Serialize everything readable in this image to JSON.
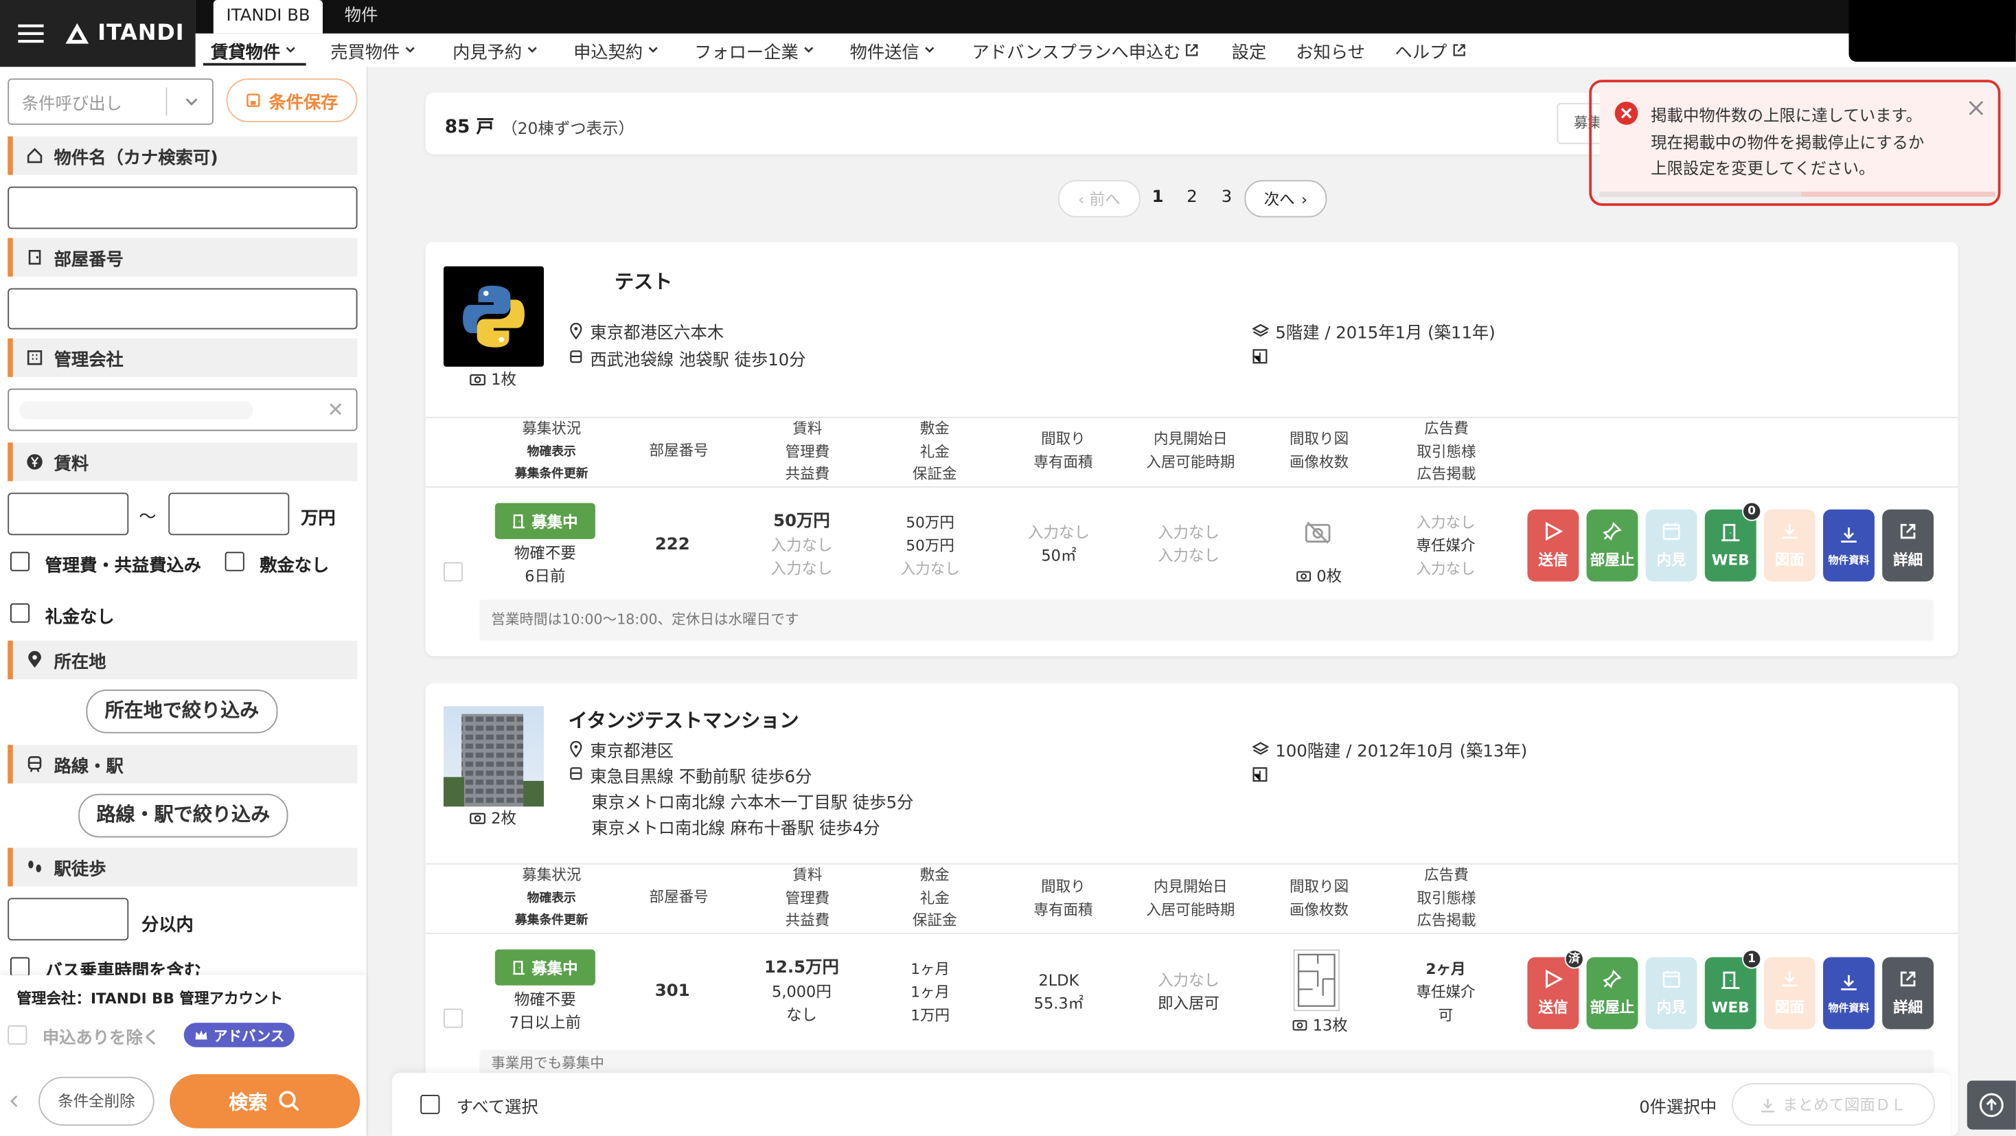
{
  "brand": {
    "name": "ITANDI"
  },
  "top_tabs": [
    "ITANDI BB",
    "物件"
  ],
  "nav": [
    "賃貸物件",
    "売買物件",
    "内見予約",
    "申込契約",
    "フォロー企業",
    "物件送信",
    "アドバンスプランへ申込む",
    "設定",
    "お知らせ",
    "ヘルプ"
  ],
  "sidebar": {
    "saved_select_placeholder": "条件呼び出し",
    "save_button": "条件保存",
    "sections": {
      "name": "物件名（カナ検索可)",
      "room": "部屋番号",
      "company": "管理会社",
      "rent": "賃料",
      "location": "所在地",
      "line": "路線・駅",
      "walk": "駅徒歩"
    },
    "rent_sep": "～",
    "rent_unit": "万円",
    "chk_mgmt": "管理費・共益費込み",
    "chk_deposit": "敷金なし",
    "chk_keymoney": "礼金なし",
    "location_button": "所在地で絞り込み",
    "line_button": "路線・駅で絞り込み",
    "walk_unit": "分以内",
    "bus_label": "バス乗車時間を含む",
    "company_account": "管理会社：ITANDI BB 管理アカウント",
    "exclude_apps": "申込ありを除く",
    "advance_badge": "アドバンス",
    "clear_button": "条件全削除",
    "search_button": "検索"
  },
  "summary": {
    "count": "85 戸",
    "note": "（20棟ずつ表示）",
    "sort_label": "募集"
  },
  "pagination": {
    "prev": "前へ",
    "pages": [
      "1",
      "2",
      "3"
    ],
    "next": "次へ"
  },
  "toast": {
    "line1": "掲載中物件数の上限に達しています。",
    "line2": "現在掲載中の物件を掲載停止にするか",
    "line3": "上限設定を変更してください。",
    "color": "#e0322d"
  },
  "headers": {
    "status": "募集状況",
    "status_sub1": "物確表示",
    "status_sub2": "募集条件更新",
    "room": "部屋番号",
    "rent1": "賃料",
    "rent2": "管理費",
    "rent3": "共益費",
    "dep1": "敷金",
    "dep2": "礼金",
    "dep3": "保証金",
    "lay1": "間取り",
    "lay2": "専有面積",
    "view1": "内見開始日",
    "view2": "入居可能時期",
    "fp1": "間取り図",
    "fp2": "画像枚数",
    "ad1": "広告費",
    "ad2": "取引態様",
    "ad3": "広告掲載"
  },
  "properties": [
    {
      "name": "テスト",
      "address": "東京都港区六本木",
      "station": "西武池袋線 池袋駅 徒歩10分",
      "stations_extra": [],
      "building": "5階建 / 2015年1月 (築11年)",
      "photos": "1枚",
      "room": {
        "status": "募集中",
        "confirm": "物確不要",
        "updated": "6日前",
        "number": "222",
        "rent": "50万円",
        "mgmt": "入力なし",
        "common": "入力なし",
        "deposit": "50万円",
        "key": "50万円",
        "guarantee": "入力なし",
        "layout": "入力なし",
        "area": "50㎡",
        "view_start": "入力なし",
        "move_in": "入力なし",
        "fp_count": "0枚",
        "ad_fee": "入力なし",
        "deal": "専任媒介",
        "ad_post": "入力なし",
        "note": "営業時間は10:00～18:00、定休日は水曜日です",
        "web_badge": "0",
        "send_badge": ""
      }
    },
    {
      "name": "イタンジテストマンション",
      "address": "東京都港区",
      "station": "東急目黒線 不動前駅 徒歩6分",
      "stations_extra": [
        "東京メトロ南北線 六本木一丁目駅 徒歩5分",
        "東京メトロ南北線 麻布十番駅 徒歩4分"
      ],
      "building": "100階建 / 2012年10月 (築13年)",
      "photos": "2枚",
      "room": {
        "status": "募集中",
        "confirm": "物確不要",
        "updated": "7日以上前",
        "number": "301",
        "rent": "12.5万円",
        "mgmt": "5,000円",
        "common": "なし",
        "deposit": "1ヶ月",
        "key": "1ヶ月",
        "guarantee": "1万円",
        "layout": "2LDK",
        "area": "55.3㎡",
        "view_start": "入力なし",
        "move_in": "即入居可",
        "fp_count": "13枚",
        "ad_fee": "2ヶ月",
        "deal": "専任媒介",
        "ad_post": "可",
        "note": "事業用でも募集中",
        "web_badge": "1",
        "send_badge": "済"
      }
    }
  ],
  "actions": [
    "送信",
    "部屋止",
    "内見",
    "WEB",
    "図面",
    "物件資料",
    "詳細"
  ],
  "bottom": {
    "select_all": "すべて選択",
    "selected": "0件選択中",
    "bulk_dl": "まとめて図面ＤＬ"
  },
  "colors": {
    "send": "#e05a56",
    "stop": "#52a352",
    "web": "#3e9a5a",
    "doc": "#3b53b8",
    "detail": "#555a60",
    "search": "#f28c3e"
  }
}
